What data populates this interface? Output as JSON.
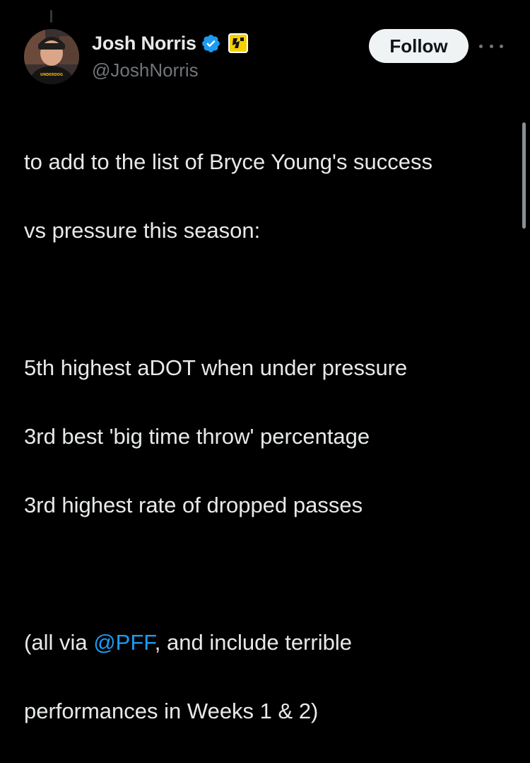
{
  "author": {
    "display_name": "Josh Norris",
    "handle": "@JoshNorris",
    "avatar_hat_text": "UNDERDOG"
  },
  "actions": {
    "follow_label": "Follow"
  },
  "tweet": {
    "line1": "to add to the list of Bryce Young's success",
    "line2": "vs pressure this season:",
    "line3": "5th highest aDOT when under pressure",
    "line4": "3rd best 'big time throw' percentage",
    "line5": "3rd highest rate of dropped passes",
    "line6_prefix": "(all via ",
    "line6_mention": "@PFF",
    "line6_suffix": ", and include terrible",
    "line7": "performances in Weeks 1 & 2)"
  },
  "colors": {
    "background": "#000000",
    "text": "#e7e9ea",
    "secondary": "#71767b",
    "accent": "#1d9bf0",
    "follow_bg": "#eff3f4",
    "affiliate_badge": "#f5d000"
  },
  "icons": {
    "verified": "verified-badge-icon",
    "affiliate": "underdog-affiliate-icon",
    "more": "more-options-icon"
  }
}
